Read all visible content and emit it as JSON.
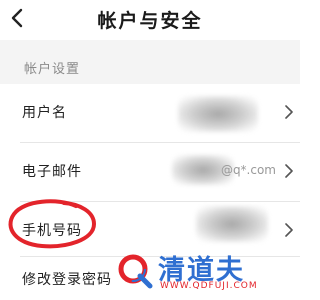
{
  "header": {
    "title": "帐户与安全",
    "back_icon": "chevron-left-icon"
  },
  "section": {
    "label": "帐户设置"
  },
  "rows": [
    {
      "label": "用户名",
      "value": "",
      "value_blurred": true
    },
    {
      "label": "电子邮件",
      "value": "@q*.com",
      "value_blurred": true
    },
    {
      "label": "手机号码",
      "value": "",
      "value_blurred": true
    },
    {
      "label": "修改登录密码",
      "value": ""
    }
  ],
  "watermark": {
    "text": "清道夫",
    "url": "WWW.QDFUJI.COM"
  },
  "colors": {
    "background": "#ffffff",
    "section_bg": "#f4f4f4",
    "accent_circle": "#e3242b",
    "watermark_blue": "#2f6fd1"
  }
}
